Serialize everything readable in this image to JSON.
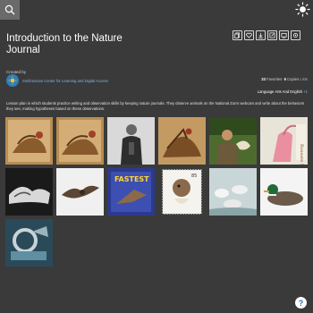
{
  "header": {
    "title": "Introduction to the Nature Journal",
    "search_icon": "search-icon",
    "logo_icon": "smithsonian-sun-icon"
  },
  "toolbar": {
    "icons": [
      "copy-icon",
      "favorite-heart-icon",
      "download-icon",
      "share-icon",
      "embed-icon",
      "settings-icon"
    ]
  },
  "creator": {
    "label": "Created by",
    "name": "Smithsonian Center for Learning and Digital Access"
  },
  "stats": {
    "favorites_count": "33",
    "favorites_label": "Favorites",
    "copies_count": "6",
    "copies_label": "Copies",
    "copies_link": "Lists"
  },
  "subject": {
    "text": "Language Arts And English",
    "more": "+1"
  },
  "description": "Lesson plan in which students practice writing and observation skills by keeping nature journals. They observe animals on the National Zoo's webcam and write about the behaviors they see, making hypotheses based on these observations.",
  "tiles": [
    {
      "name": "bird-painting-1"
    },
    {
      "name": "bird-painting-2"
    },
    {
      "name": "portrait-soldier"
    },
    {
      "name": "bird-painting-3"
    },
    {
      "name": "man-with-bird"
    },
    {
      "name": "roseate-spoonbill"
    },
    {
      "name": "birds-black-white"
    },
    {
      "name": "bird-in-flight"
    },
    {
      "name": "fastest-stamp"
    },
    {
      "name": "falcon-stamp"
    },
    {
      "name": "birds-on-water"
    },
    {
      "name": "duck-decoy"
    },
    {
      "name": "bird-band-tag"
    }
  ],
  "colors": {
    "background": "#3a3a3a",
    "link": "#7fb6e0",
    "accent": "#2a73b8"
  },
  "help": {
    "label": "?"
  }
}
